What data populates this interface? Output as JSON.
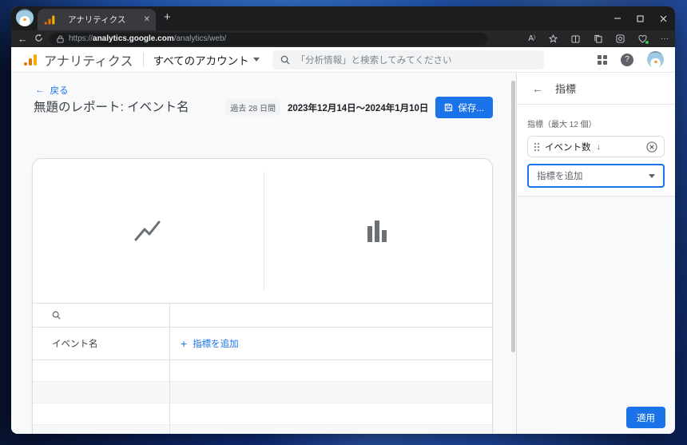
{
  "browser": {
    "tab_title": "アナリティクス",
    "url_scheme": "https://",
    "url_host": "analytics.google.com",
    "url_path": "/analytics/web/",
    "icons": {
      "close_tab": "✕",
      "new_tab": "+",
      "back": "←",
      "read_aloud": "A",
      "more": "···"
    }
  },
  "ga_header": {
    "brand": "アナリティクス",
    "account_switcher": "すべてのアカウント",
    "search_placeholder": "「分析情報」と検索してみてください"
  },
  "report": {
    "back_label": "戻る",
    "back_arrow": "←",
    "title": "無題のレポート: イベント名",
    "date_period_chip": "過去 28 日間",
    "date_range": "2023年12月14日～2024年1月10日",
    "save_button": "保存..."
  },
  "table": {
    "dimension_column_header": "イベント名",
    "add_metric_link": "指標を追加",
    "plus_glyph": "+"
  },
  "metrics_panel": {
    "back_arrow": "←",
    "title": "指標",
    "limit_label": "指標（最大 12 個）",
    "metric_items": [
      {
        "label": "イベント数",
        "sort_arrow": "↓"
      }
    ],
    "add_metric_placeholder": "指標を追加",
    "apply_button": "適用"
  },
  "colors": {
    "accent_blue": "#1a73e8",
    "logo_orange": "#f9ab00",
    "logo_dark_orange": "#e37400",
    "content_background": "#f8f9fa"
  }
}
